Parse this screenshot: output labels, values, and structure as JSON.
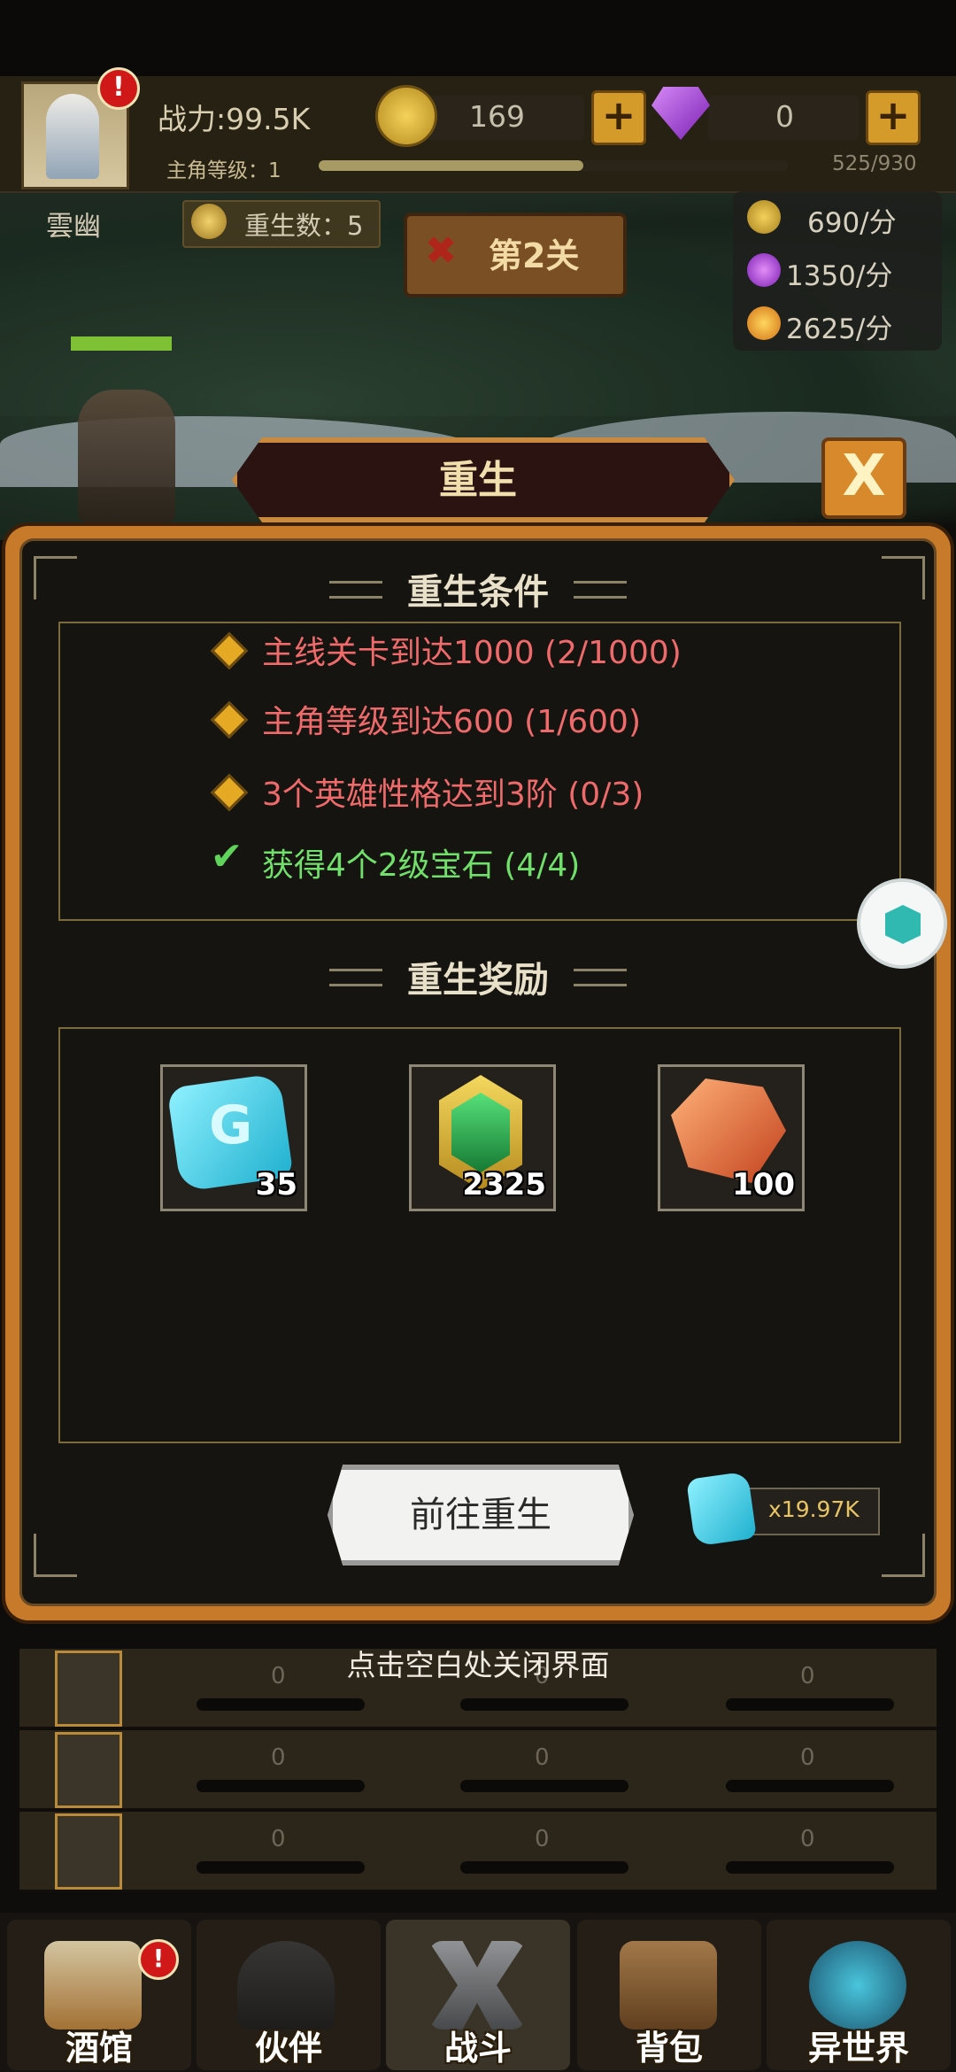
{
  "header": {
    "power": "战力:99.5K",
    "level_label": "主角等级：1",
    "exp_text": "525/930",
    "exp_progress": 0.5645,
    "coins": "169",
    "gems": "0",
    "alert_badge": "!"
  },
  "hero": {
    "name": "雲幽",
    "rebirth_count": "重生数：5"
  },
  "stage": {
    "label": "第2关"
  },
  "rates": [
    "690/分",
    "1350/分",
    "2625/分"
  ],
  "dialog": {
    "title": "重生",
    "close_label": "X",
    "conditions_title": "重生条件",
    "conditions": [
      {
        "text": "主线关卡到达1000 (2/1000)",
        "met": false
      },
      {
        "text": "主角等级到达600 (1/600)",
        "met": false
      },
      {
        "text": "3个英雄性格达到3阶 (0/3)",
        "met": false
      },
      {
        "text": "获得4个2级宝石 (4/4)",
        "met": true
      }
    ],
    "check_mark": "✔",
    "rewards_title": "重生奖励",
    "rewards": [
      {
        "icon": "blue-rune-stone-icon",
        "quantity": "35"
      },
      {
        "icon": "green-emblem-icon",
        "quantity": "2325"
      },
      {
        "icon": "orange-crystal-icon",
        "quantity": "100"
      }
    ],
    "rune_glyph": "G",
    "go_button": "前往重生",
    "owned_cost": "x19.97K"
  },
  "close_hint": "点击空白处关闭界面",
  "list_rows": [
    {
      "values": [
        "0",
        "0",
        "0"
      ]
    },
    {
      "values": [
        "0",
        "0",
        "0"
      ]
    },
    {
      "values": [
        "0",
        "0",
        "0"
      ]
    }
  ],
  "bottom_nav": [
    {
      "label": "酒馆",
      "icon": "tavern-mug-icon",
      "alert": true
    },
    {
      "label": "伙伴",
      "icon": "partner-icon",
      "alert": false
    },
    {
      "label": "战斗",
      "icon": "crossed-swords-icon",
      "active": true
    },
    {
      "label": "背包",
      "icon": "backpack-icon",
      "alert": false
    },
    {
      "label": "异世界",
      "icon": "portal-icon",
      "alert": false
    }
  ],
  "colors": {
    "condition_unmet": "#ef6a6a",
    "condition_met": "#70e06a",
    "dialog_frame": "#c77a2a",
    "accent_gold": "#e8c463"
  }
}
